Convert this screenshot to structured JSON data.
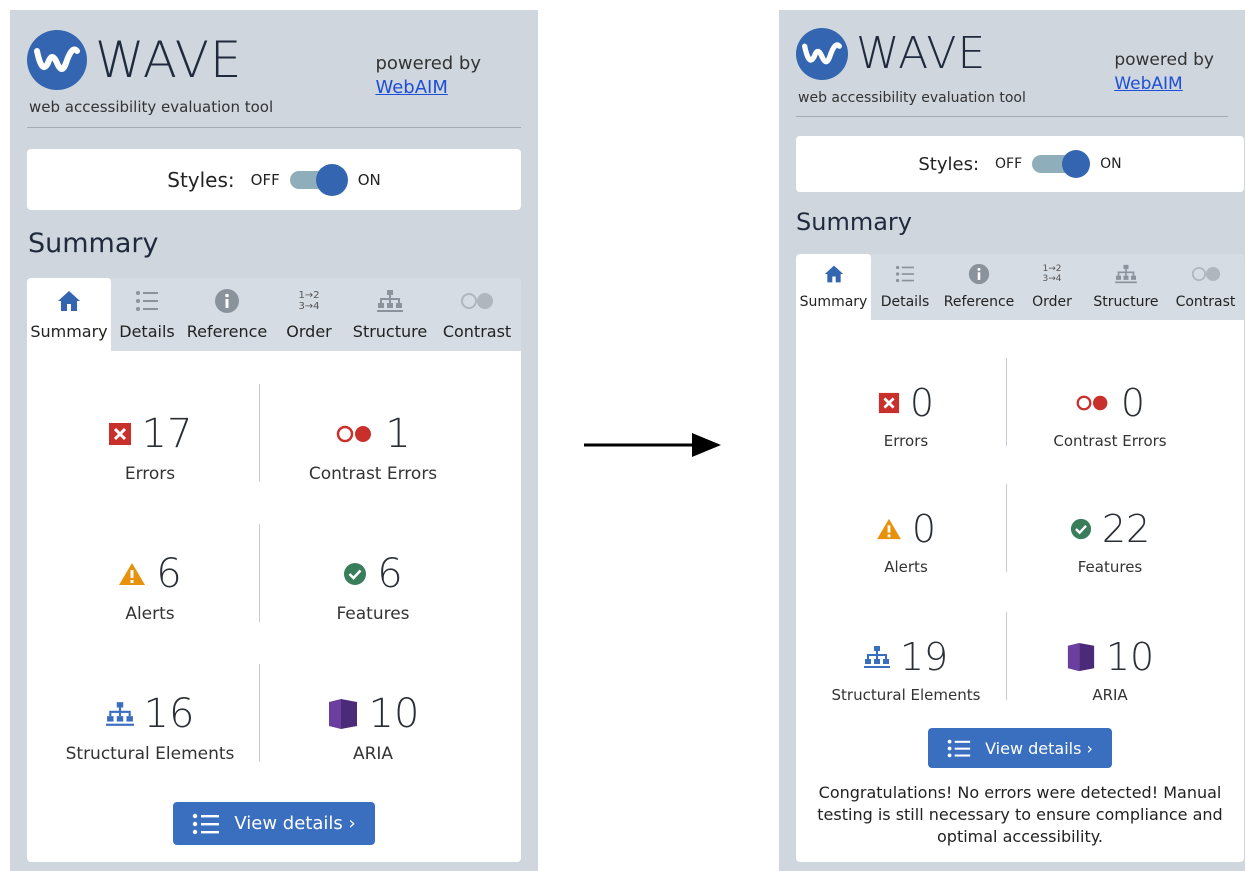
{
  "app": {
    "name": "WAVE",
    "tagline": "web accessibility evaluation tool",
    "powered_by": "powered by",
    "powered_link": "WebAIM"
  },
  "styles_toggle": {
    "label": "Styles:",
    "off": "OFF",
    "on": "ON",
    "state": "on"
  },
  "heading": "Summary",
  "tabs": [
    {
      "label": "Summary",
      "icon": "home-icon",
      "active": true
    },
    {
      "label": "Details",
      "icon": "list-icon"
    },
    {
      "label": "Reference",
      "icon": "info-icon"
    },
    {
      "label": "Order",
      "icon": "order-icon"
    },
    {
      "label": "Structure",
      "icon": "structure-icon"
    },
    {
      "label": "Contrast",
      "icon": "contrast-icon"
    }
  ],
  "order_icon_text": {
    "top": "1→2",
    "bottom": "3→4"
  },
  "before": {
    "errors": {
      "value": "17",
      "label": "Errors"
    },
    "contrast_errors": {
      "value": "1",
      "label": "Contrast Errors"
    },
    "alerts": {
      "value": "6",
      "label": "Alerts"
    },
    "features": {
      "value": "6",
      "label": "Features"
    },
    "structural": {
      "value": "16",
      "label": "Structural Elements"
    },
    "aria": {
      "value": "10",
      "label": "ARIA"
    },
    "view_details": "View details ›"
  },
  "after": {
    "errors": {
      "value": "0",
      "label": "Errors"
    },
    "contrast_errors": {
      "value": "0",
      "label": "Contrast Errors"
    },
    "alerts": {
      "value": "0",
      "label": "Alerts"
    },
    "features": {
      "value": "22",
      "label": "Features"
    },
    "structural": {
      "value": "19",
      "label": "Structural Elements"
    },
    "aria": {
      "value": "10",
      "label": "ARIA"
    },
    "view_details": "View details ›",
    "congrats": "Congratulations! No errors were detected! Manual testing is still necessary to ensure compliance and optimal accessibility."
  },
  "colors": {
    "panel_bg": "#d0d6de",
    "brand_blue": "#3465b0",
    "error_red": "#c9302c",
    "alert_orange": "#e8920c",
    "feature_green": "#3a7d5b",
    "aria_purple": "#4b2a7a",
    "link": "#1c4fd6"
  }
}
